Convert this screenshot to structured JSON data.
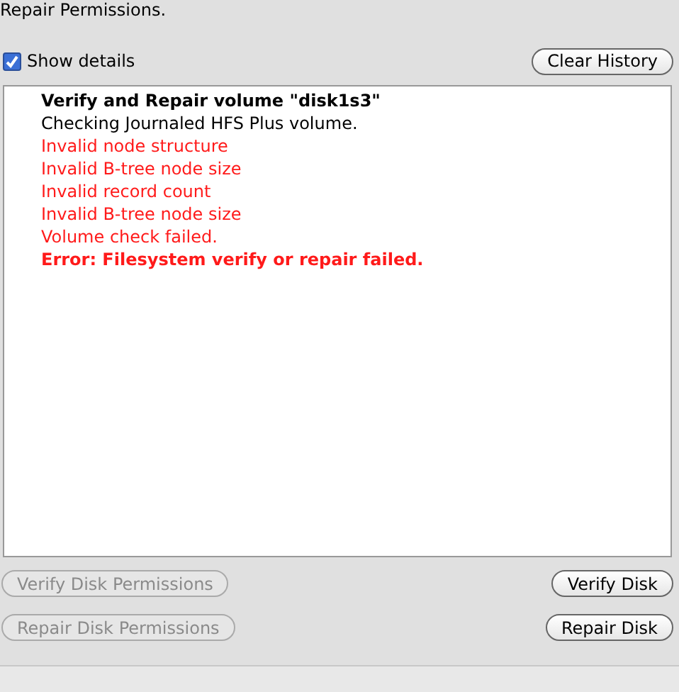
{
  "intro_text": "Repair Permissions.",
  "show_details": {
    "label": "Show details",
    "checked": true
  },
  "clear_history_button": {
    "label": "Clear History"
  },
  "log": [
    {
      "text": "Verify and Repair volume \"disk1s3\"",
      "kind": "heading"
    },
    {
      "text": "Checking Journaled HFS Plus volume.",
      "kind": "info"
    },
    {
      "text": "Invalid node structure",
      "kind": "error"
    },
    {
      "text": "Invalid B-tree node size",
      "kind": "error"
    },
    {
      "text": "Invalid record count",
      "kind": "error"
    },
    {
      "text": "Invalid B-tree node size",
      "kind": "error"
    },
    {
      "text": "Volume check failed.",
      "kind": "error"
    },
    {
      "text": "Error: Filesystem verify or repair failed.",
      "kind": "fatal"
    }
  ],
  "button_rows": [
    {
      "left": {
        "label": "Verify Disk Permissions",
        "disabled": true
      },
      "right": {
        "label": "Verify Disk",
        "disabled": false
      }
    },
    {
      "left": {
        "label": "Repair Disk Permissions",
        "disabled": true
      },
      "right": {
        "label": "Repair Disk",
        "disabled": false
      }
    }
  ]
}
